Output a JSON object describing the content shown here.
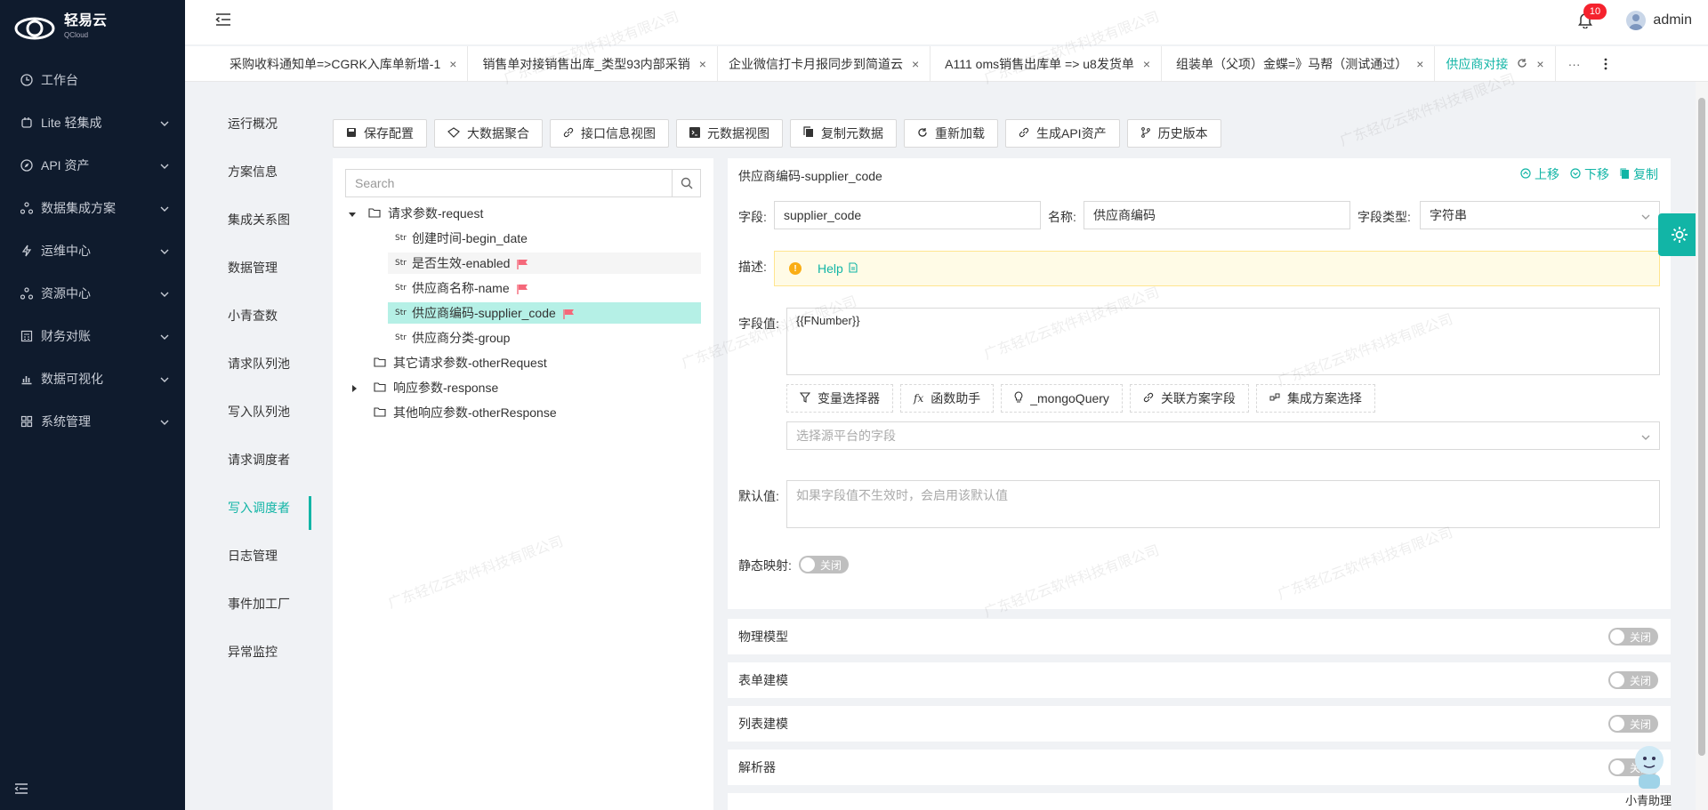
{
  "brand": {
    "name": "轻易云",
    "sub": "QCloud"
  },
  "sidebar": {
    "items": [
      {
        "label": "工作台",
        "icon": "clock-icon",
        "expandable": false
      },
      {
        "label": "Lite 轻集成",
        "icon": "lite-icon",
        "expandable": true
      },
      {
        "label": "API 资产",
        "icon": "compass-icon",
        "expandable": true
      },
      {
        "label": "数据集成方案",
        "icon": "cluster-icon",
        "expandable": true
      },
      {
        "label": "运维中心",
        "icon": "bolt-icon",
        "expandable": true
      },
      {
        "label": "资源中心",
        "icon": "cluster-icon",
        "expandable": true
      },
      {
        "label": "财务对账",
        "icon": "calculator-icon",
        "expandable": true
      },
      {
        "label": "数据可视化",
        "icon": "chart-icon",
        "expandable": true
      },
      {
        "label": "系统管理",
        "icon": "apps-icon",
        "expandable": true
      }
    ]
  },
  "header": {
    "notification_count": "10",
    "user": "admin"
  },
  "tabs": [
    {
      "label": "采购收料通知单=>CGRK入库单新增-1",
      "active": false
    },
    {
      "label": "销售单对接销售出库_类型93内部采销",
      "active": false
    },
    {
      "label": "企业微信打卡月报同步到简道云",
      "active": false
    },
    {
      "label": "A111 oms销售出库单 => u8发货单",
      "active": false
    },
    {
      "label": "组装单（父项）金蝶=》马帮（测试通过）",
      "active": false
    },
    {
      "label": "供应商对接",
      "active": true
    }
  ],
  "tab_more": "···",
  "subnav": [
    {
      "label": "运行概况",
      "active": false
    },
    {
      "label": "方案信息",
      "active": false
    },
    {
      "label": "集成关系图",
      "active": false
    },
    {
      "label": "数据管理",
      "active": false
    },
    {
      "label": "小青查数",
      "active": false
    },
    {
      "label": "请求队列池",
      "active": false
    },
    {
      "label": "写入队列池",
      "active": false
    },
    {
      "label": "请求调度者",
      "active": false
    },
    {
      "label": "写入调度者",
      "active": true
    },
    {
      "label": "日志管理",
      "active": false
    },
    {
      "label": "事件加工厂",
      "active": false
    },
    {
      "label": "异常监控",
      "active": false
    }
  ],
  "toolbar": {
    "save": "保存配置",
    "bigdata": "大数据聚合",
    "api_view": "接口信息视图",
    "meta_view": "元数据视图",
    "copy_meta": "复制元数据",
    "reload": "重新加载",
    "gen_api": "生成API资产",
    "history": "历史版本"
  },
  "tree": {
    "search_placeholder": "Search",
    "nodes": [
      {
        "label": "请求参数-request"
      },
      {
        "label": "创建时间-begin_date",
        "type": "Str"
      },
      {
        "label": "是否生效-enabled",
        "type": "Str"
      },
      {
        "label": "供应商名称-name",
        "type": "Str"
      },
      {
        "label": "供应商编码-supplier_code",
        "type": "Str"
      },
      {
        "label": "供应商分类-group",
        "type": "Str"
      },
      {
        "label": "其它请求参数-otherRequest"
      },
      {
        "label": "响应参数-response"
      },
      {
        "label": "其他响应参数-otherResponse"
      }
    ]
  },
  "form": {
    "title": "供应商编码-supplier_code",
    "actions": {
      "up": "上移",
      "down": "下移",
      "copy": "复制"
    },
    "field_label": "字段:",
    "field_value": "supplier_code",
    "name_label": "名称:",
    "name_value": "供应商编码",
    "type_label": "字段类型:",
    "type_value": "字符串",
    "desc_label": "描述:",
    "help": "Help",
    "value_label": "字段值:",
    "value": "{{FNumber}}",
    "helpers": {
      "var": "变量选择器",
      "func": "函数助手",
      "mongo": "_mongoQuery",
      "link": "关联方案字段",
      "scheme": "集成方案选择"
    },
    "source_placeholder": "选择源平台的字段",
    "default_label": "默认值:",
    "default_placeholder": "如果字段值不生效时，会启用该默认值",
    "static_label": "静态映射:",
    "toggle_off": "关闭"
  },
  "sections": [
    {
      "label": "物理模型",
      "toggle": "关闭"
    },
    {
      "label": "表单建模",
      "toggle": "关闭"
    },
    {
      "label": "列表建模",
      "toggle": "关闭"
    },
    {
      "label": "解析器",
      "toggle": "关闭"
    }
  ],
  "assistant": {
    "label": "小青助理"
  },
  "watermark": "广东轻亿云软件科技有限公司",
  "colors": {
    "accent": "#12b5a6",
    "sidebar": "#0f1b2d",
    "flag": "#f5687a"
  }
}
